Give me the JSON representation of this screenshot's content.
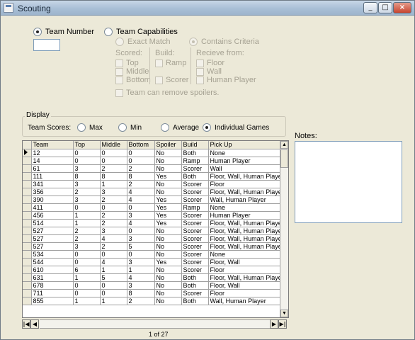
{
  "window": {
    "title": "Scouting"
  },
  "search": {
    "team_number_label": "Team Number",
    "team_number_value": "",
    "team_capabilities_label": "Team Capabilities",
    "exact_match_label": "Exact Match",
    "contains_criteria_label": "Contains Criteria",
    "scored_label": "Scored:",
    "scored_options": [
      "Top",
      "Middle",
      "Bottom"
    ],
    "build_label": "Build:",
    "build_options": [
      "Ramp",
      "Scorer"
    ],
    "receive_label": "Recieve from:",
    "receive_options": [
      "Floor",
      "Wall",
      "Human Player"
    ],
    "remove_spoilers_label": "Team can remove spoilers."
  },
  "display": {
    "group_title": "Display",
    "team_scores_label": "Team Scores:",
    "options": [
      "Max",
      "Min",
      "Average",
      "Individual Games"
    ],
    "selected": "Individual Games"
  },
  "grid": {
    "columns": [
      "Team",
      "Top",
      "Middle",
      "Bottom",
      "Spoiler",
      "Build",
      "Pick Up"
    ],
    "rows": [
      [
        "12",
        "0",
        "0",
        "0",
        "No",
        "Both",
        "None"
      ],
      [
        "14",
        "0",
        "0",
        "0",
        "No",
        "Ramp",
        "Human Player"
      ],
      [
        "61",
        "3",
        "2",
        "2",
        "No",
        "Scorer",
        "Wall"
      ],
      [
        "111",
        "8",
        "8",
        "8",
        "Yes",
        "Both",
        "Floor, Wall, Human Player"
      ],
      [
        "341",
        "3",
        "1",
        "2",
        "No",
        "Scorer",
        "Floor"
      ],
      [
        "356",
        "2",
        "3",
        "4",
        "No",
        "Scorer",
        "Floor, Wall, Human Player"
      ],
      [
        "390",
        "3",
        "2",
        "4",
        "Yes",
        "Scorer",
        "Wall, Human Player"
      ],
      [
        "411",
        "0",
        "0",
        "0",
        "Yes",
        "Ramp",
        "None"
      ],
      [
        "456",
        "1",
        "2",
        "3",
        "Yes",
        "Scorer",
        "Human Player"
      ],
      [
        "514",
        "1",
        "2",
        "4",
        "Yes",
        "Scorer",
        "Floor, Wall, Human Player"
      ],
      [
        "527",
        "2",
        "3",
        "0",
        "No",
        "Scorer",
        "Floor, Wall, Human Player"
      ],
      [
        "527",
        "2",
        "4",
        "3",
        "No",
        "Scorer",
        "Floor, Wall, Human Player"
      ],
      [
        "527",
        "3",
        "2",
        "5",
        "No",
        "Scorer",
        "Floor, Wall, Human Player"
      ],
      [
        "534",
        "0",
        "0",
        "0",
        "No",
        "Scorer",
        "None"
      ],
      [
        "544",
        "0",
        "4",
        "3",
        "Yes",
        "Scorer",
        "Floor, Wall"
      ],
      [
        "610",
        "6",
        "1",
        "1",
        "No",
        "Scorer",
        "Floor"
      ],
      [
        "631",
        "1",
        "5",
        "4",
        "No",
        "Both",
        "Floor, Wall, Human Player"
      ],
      [
        "678",
        "0",
        "0",
        "3",
        "No",
        "Both",
        "Floor, Wall"
      ],
      [
        "711",
        "0",
        "0",
        "8",
        "No",
        "Scorer",
        "Floor"
      ],
      [
        "855",
        "1",
        "1",
        "2",
        "No",
        "Both",
        "Wall, Human Player"
      ]
    ],
    "pager_text": "1 of 27"
  },
  "notes": {
    "label": "Notes:",
    "value": ""
  },
  "icons": {
    "first": "first-record-icon",
    "prev": "previous-record-icon",
    "next": "next-record-icon",
    "last": "last-record-icon"
  },
  "colors": {
    "titlebar": "#a9bfd6",
    "close_button": "#c8452f",
    "window": "#ece9d8"
  }
}
